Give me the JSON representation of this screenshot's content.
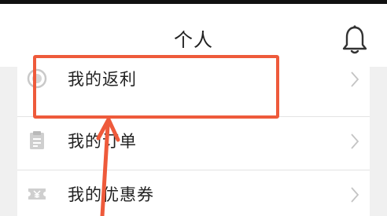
{
  "header": {
    "title": "个人"
  },
  "menu": {
    "items": [
      {
        "label": "我的返利",
        "icon": "rebate-coin-icon"
      },
      {
        "label": "我的订单",
        "icon": "order-clipboard-icon"
      },
      {
        "label": "我的优惠券",
        "icon": "coupon-icon"
      }
    ]
  },
  "annotation": {
    "color": "#ee5a3b",
    "highlighted_item": "我的返利"
  }
}
